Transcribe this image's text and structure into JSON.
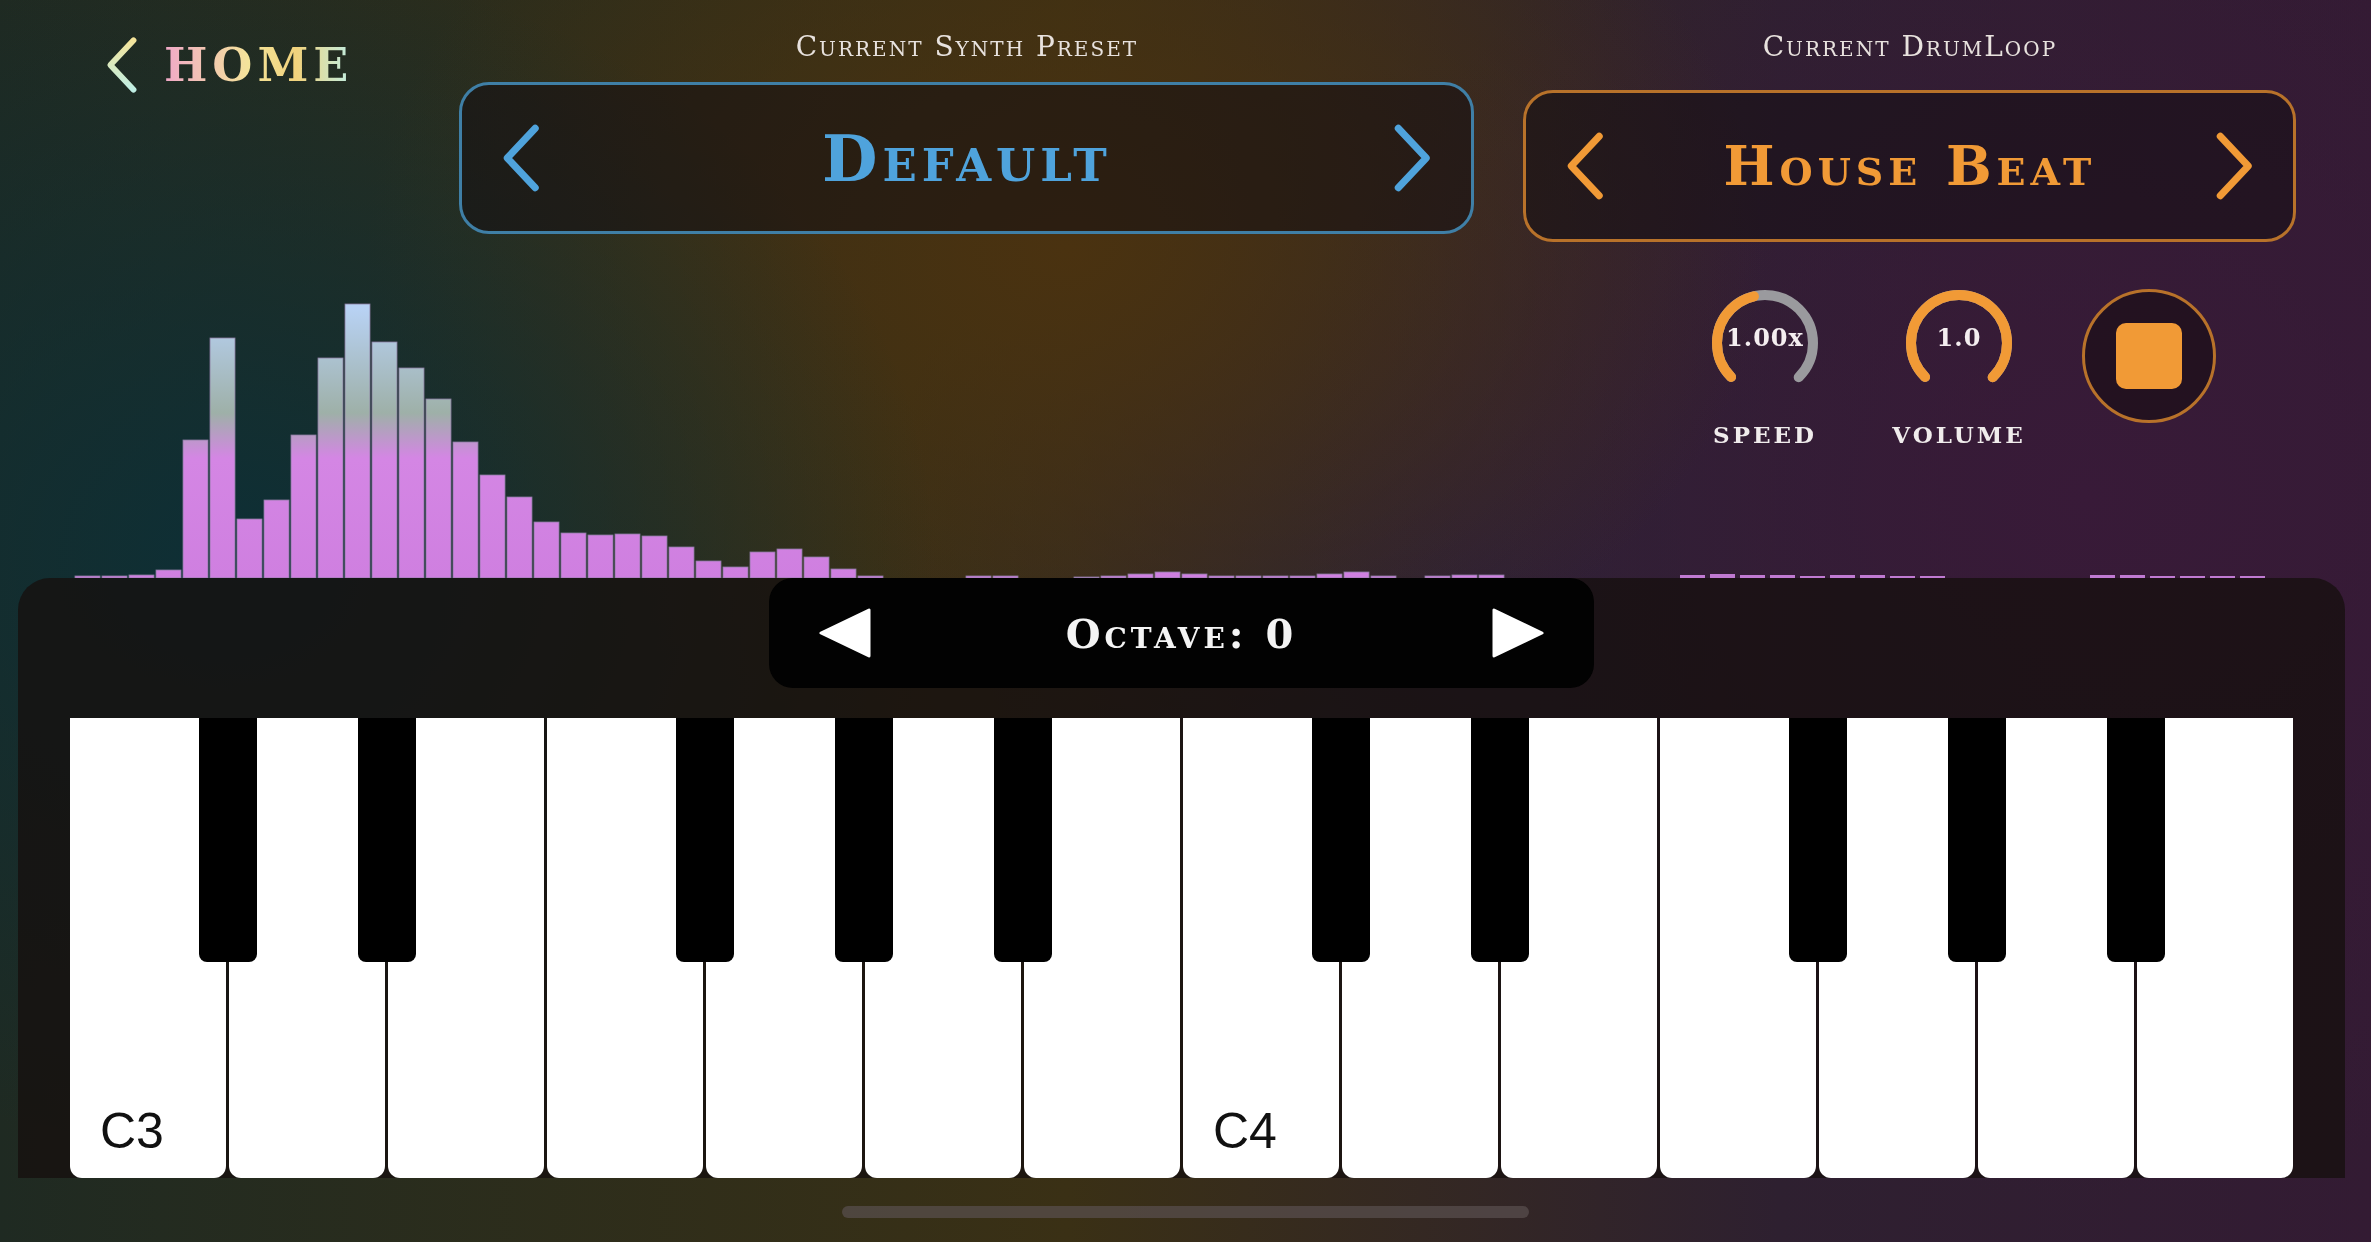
{
  "home_button": {
    "label": "HOME"
  },
  "synth_preset": {
    "heading": "Current Synth Preset",
    "name": "Default"
  },
  "drumloop": {
    "heading": "Current DrumLoop",
    "name": "House Beat",
    "playing": true,
    "knobs": [
      {
        "label": "SPEED",
        "reading": "1.00x"
      },
      {
        "label": "VOLUME",
        "reading": "1.0"
      }
    ]
  },
  "keyboard": {
    "octave": "Octave: 0",
    "keys": [
      {
        "kind": "white",
        "label": "C3"
      },
      {
        "kind": "black"
      },
      {
        "kind": "white"
      },
      {
        "kind": "black"
      },
      {
        "kind": "white"
      },
      {
        "kind": "white"
      },
      {
        "kind": "black"
      },
      {
        "kind": "white"
      },
      {
        "kind": "black"
      },
      {
        "kind": "white"
      },
      {
        "kind": "black"
      },
      {
        "kind": "white"
      },
      {
        "kind": "white",
        "label": "C4"
      },
      {
        "kind": "black"
      },
      {
        "kind": "white"
      },
      {
        "kind": "black"
      },
      {
        "kind": "white"
      },
      {
        "kind": "white"
      },
      {
        "kind": "black"
      },
      {
        "kind": "white"
      },
      {
        "kind": "black"
      },
      {
        "kind": "white"
      },
      {
        "kind": "black"
      },
      {
        "kind": "white"
      }
    ]
  }
}
